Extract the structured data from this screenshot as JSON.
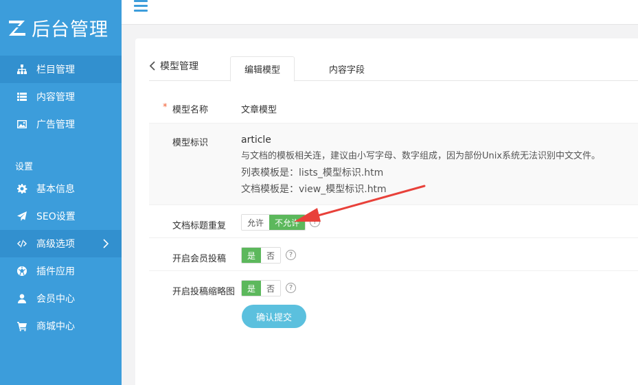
{
  "brand": {
    "logo_text": "后台管理"
  },
  "sidebar": {
    "items": [
      {
        "label": "栏目管理",
        "icon": "sitemap-icon"
      },
      {
        "label": "内容管理",
        "icon": "list-icon"
      },
      {
        "label": "广告管理",
        "icon": "image-icon"
      }
    ],
    "group_label": "设置",
    "settings_items": [
      {
        "label": "基本信息",
        "icon": "gear-icon"
      },
      {
        "label": "SEO设置",
        "icon": "paper-plane-icon"
      },
      {
        "label": "高级选项",
        "icon": "code-icon"
      },
      {
        "label": "插件应用",
        "icon": "soccer-ball-icon"
      },
      {
        "label": "会员中心",
        "icon": "user-icon"
      },
      {
        "label": "商城中心",
        "icon": "cart-icon"
      }
    ]
  },
  "tabs": {
    "back_label": "模型管理",
    "tab1": "编辑模型",
    "tab2": "内容字段"
  },
  "form": {
    "name_label": "模型名称",
    "name_value": "文章模型",
    "id_label": "模型标识",
    "id_value": "article",
    "id_help1": "与文档的模板相关连，建议由小写字母、数字组成，因为部份Unix系统无法识别中文文件。",
    "id_help2": "列表模板是：lists_模型标识.htm",
    "id_help3": "文档模板是：view_模型标识.htm",
    "dup_label": "文档标题重复",
    "dup_opt_allow": "允许",
    "dup_opt_deny": "不允许",
    "member_label": "开启会员投稿",
    "thumb_label": "开启投稿缩略图",
    "yes": "是",
    "no": "否",
    "help_mark": "?",
    "submit_label": "确认提交"
  },
  "colors": {
    "sidebar": "#3c9ddb",
    "sidebar_active": "#3290cf",
    "toggle_on": "#5cb85c",
    "submit": "#5bc0de",
    "annotation_arrow": "#e8413a"
  }
}
